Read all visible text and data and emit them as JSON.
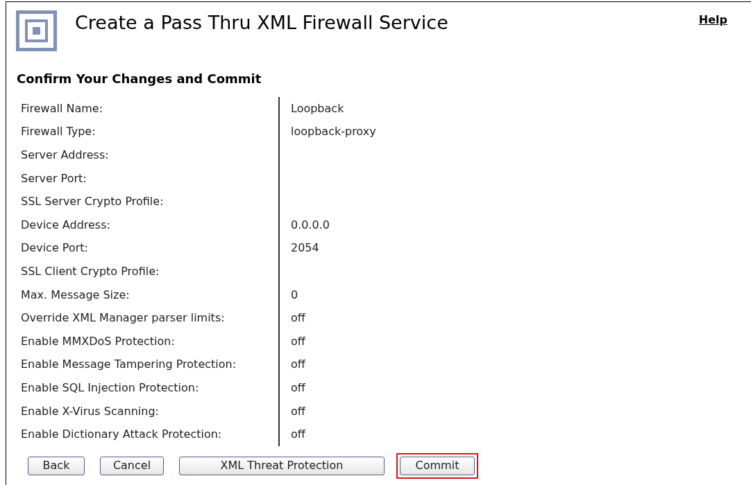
{
  "header": {
    "title": "Create a Pass Thru XML Firewall Service",
    "help_link": "Help"
  },
  "section_title": "Confirm Your Changes and Commit",
  "rows": [
    {
      "label": "Firewall Name:",
      "value": "Loopback"
    },
    {
      "label": "Firewall Type:",
      "value": "loopback-proxy"
    },
    {
      "label": "Server Address:",
      "value": ""
    },
    {
      "label": "Server Port:",
      "value": ""
    },
    {
      "label": "SSL Server Crypto Profile:",
      "value": ""
    },
    {
      "label": "Device Address:",
      "value": "0.0.0.0"
    },
    {
      "label": "Device Port:",
      "value": "2054"
    },
    {
      "label": "SSL Client Crypto Profile:",
      "value": ""
    },
    {
      "label": "Max. Message Size:",
      "value": "0"
    },
    {
      "label": "Override XML Manager parser limits:",
      "value": "off"
    },
    {
      "label": "Enable MMXDoS Protection:",
      "value": "off"
    },
    {
      "label": "Enable Message Tampering Protection:",
      "value": "off"
    },
    {
      "label": "Enable SQL Injection Protection:",
      "value": "off"
    },
    {
      "label": "Enable X-Virus Scanning:",
      "value": "off"
    },
    {
      "label": "Enable Dictionary Attack Protection:",
      "value": "off"
    }
  ],
  "buttons": [
    {
      "label": "Back",
      "highlighted": false
    },
    {
      "label": "Cancel",
      "highlighted": false
    },
    {
      "label": "XML Threat Protection",
      "highlighted": false
    },
    {
      "label": "Commit",
      "highlighted": true
    }
  ]
}
